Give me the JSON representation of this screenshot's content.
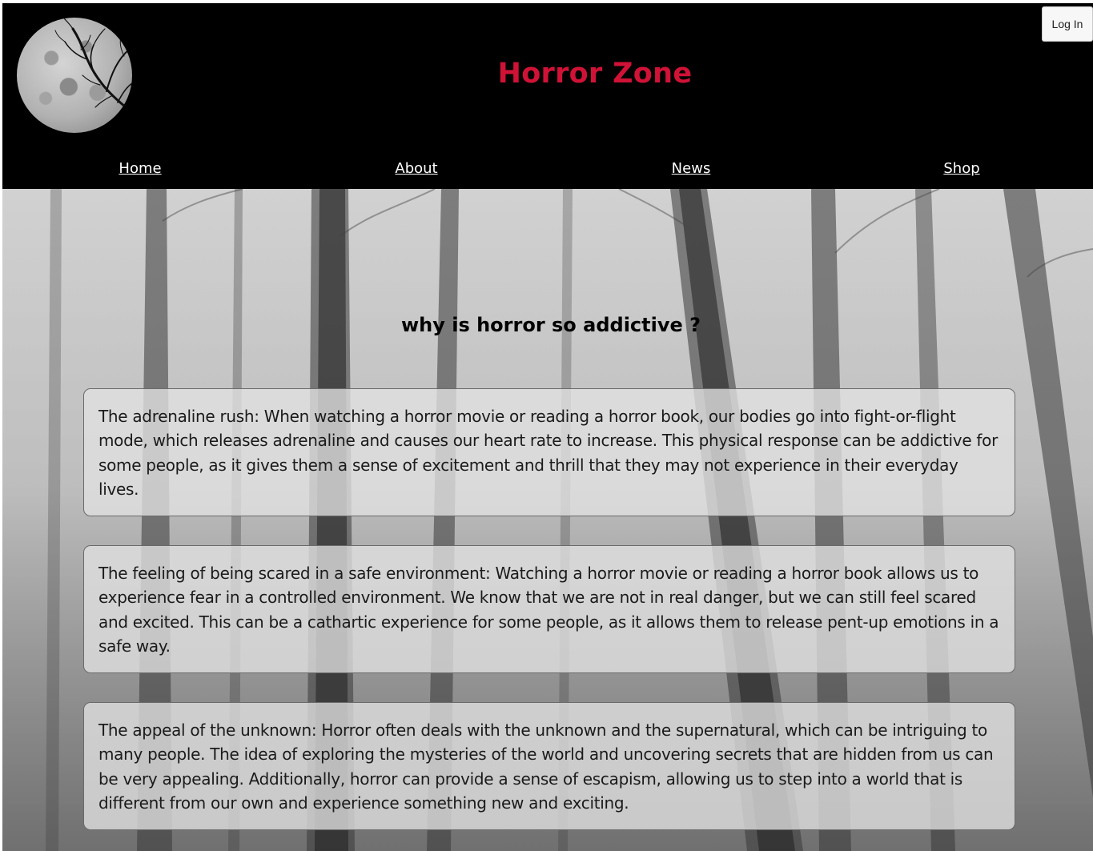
{
  "header": {
    "title": "Horror Zone",
    "logo_icon": "moon-with-branches-icon",
    "title_color": "#d01237",
    "background": "#000000"
  },
  "nav": {
    "items": [
      {
        "label": "Home"
      },
      {
        "label": "About"
      },
      {
        "label": "News"
      },
      {
        "label": "Shop"
      }
    ]
  },
  "auth": {
    "login_label": "Log In"
  },
  "main": {
    "heading": "why is horror so addictive ?",
    "cards": [
      {
        "text": "The adrenaline rush: When watching a horror movie or reading a horror book, our bodies go into fight-or-flight mode, which releases adrenaline and causes our heart rate to increase. This physical response can be addictive for some people, as it gives them a sense of excitement and thrill that they may not experience in their everyday lives."
      },
      {
        "text": "The feeling of being scared in a safe environment: Watching a horror movie or reading a horror book allows us to experience fear in a controlled environment. We know that we are not in real danger, but we can still feel scared and excited. This can be a cathartic experience for some people, as it allows them to release pent-up emotions in a safe way."
      },
      {
        "text": "The appeal of the unknown: Horror often deals with the unknown and the supernatural, which can be intriguing to many people. The idea of exploring the mysteries of the world and uncovering secrets that are hidden from us can be very appealing. Additionally, horror can provide a sense of escapism, allowing us to step into a world that is different from our own and experience something new and exciting."
      }
    ]
  }
}
